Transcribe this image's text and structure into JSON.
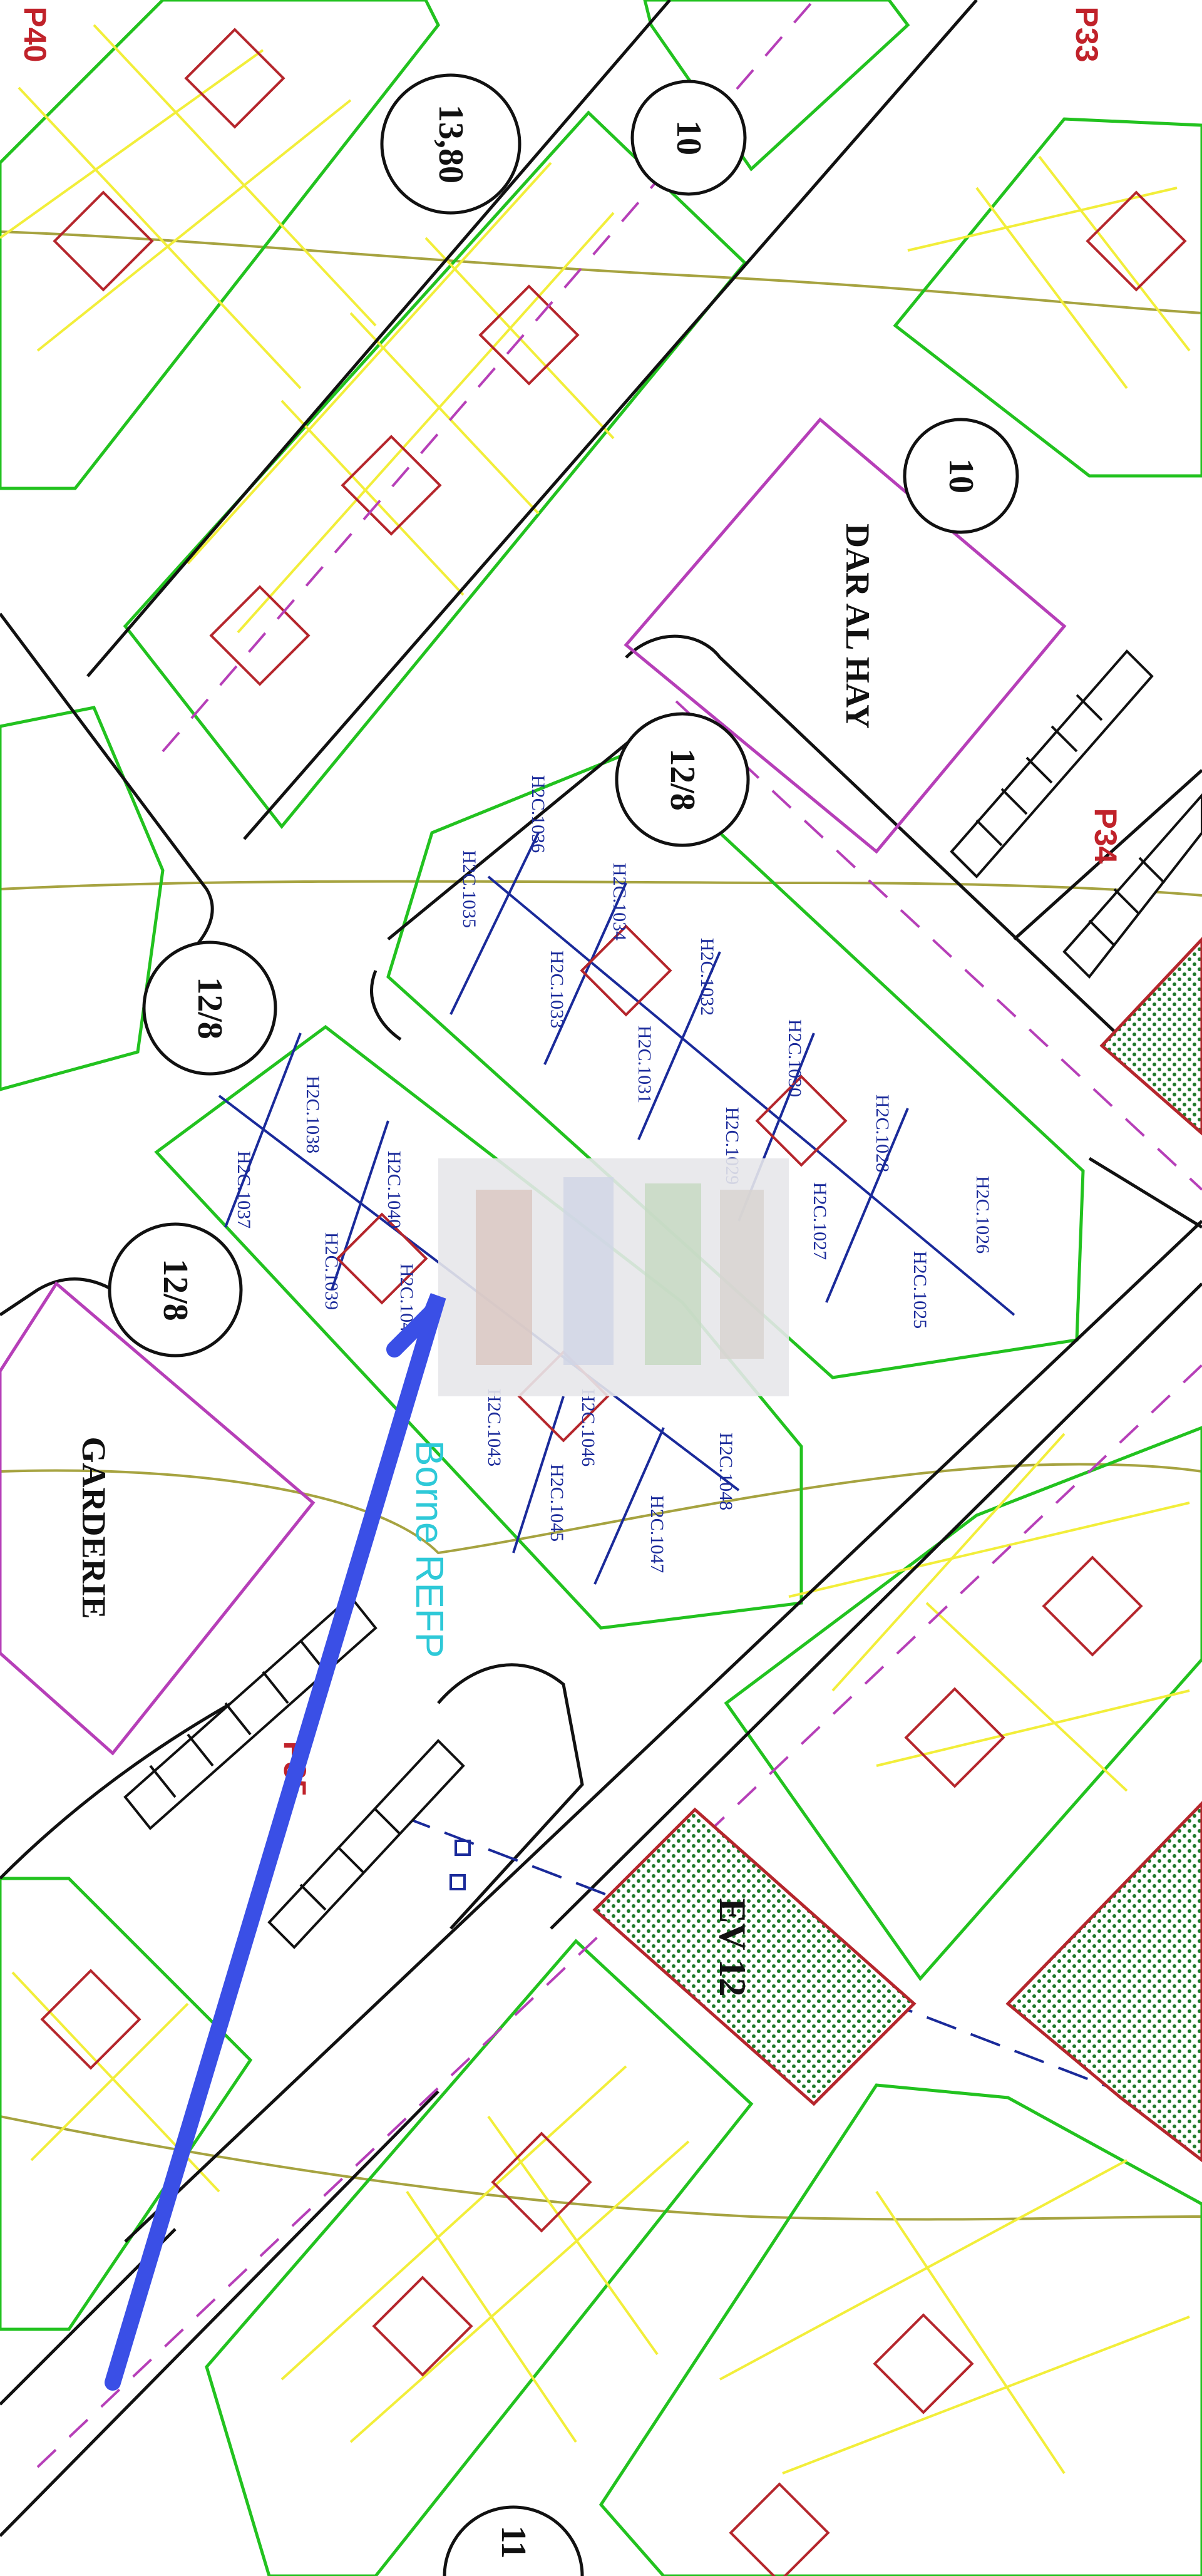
{
  "map": {
    "place_labels": {
      "dar_al_hay_line1": "DAR AL HAY",
      "garderie": "GARDERIE",
      "ev12": "EV 12",
      "borne": "Borne REFP"
    },
    "parking": {
      "p33": "P33",
      "p34": "P34",
      "p35": "P35",
      "p40": "P40"
    },
    "road_widths": {
      "w_13_80": "13,80",
      "w_10_a": "10",
      "w_10_b": "10",
      "w_12_8_a": "12/8",
      "w_12_8_b": "12/8",
      "w_12_8_c": "12/8",
      "w_11": "11"
    },
    "lots_main": [
      "H2C.1036",
      "H2C.1035",
      "H2C.1034",
      "H2C.1033",
      "H2C.1032",
      "H2C.1031",
      "H2C.1030",
      "H2C.1029",
      "H2C.1028",
      "H2C.1027",
      "H2C.1026",
      "H2C.1025"
    ],
    "lots_left": [
      "H2C.1038",
      "H2C.1037",
      "H2C.1040",
      "H2C.1039",
      "H2C.1041",
      "H2C.1043",
      "H2C.1046",
      "H2C.1045",
      "H2C.1048",
      "H2C.1047"
    ],
    "colors": {
      "parcel_green": "#22c21f",
      "road_black": "#111111",
      "lot_blue": "#1a2a9a",
      "facility_magenta": "#b63fb8",
      "marker_blue": "#3a4fe6",
      "park_red": "#b5262c",
      "contour_olive": "#a6a340",
      "grid_yellow": "#f2ee3a",
      "annot_cyan": "#2ec9d8"
    }
  }
}
